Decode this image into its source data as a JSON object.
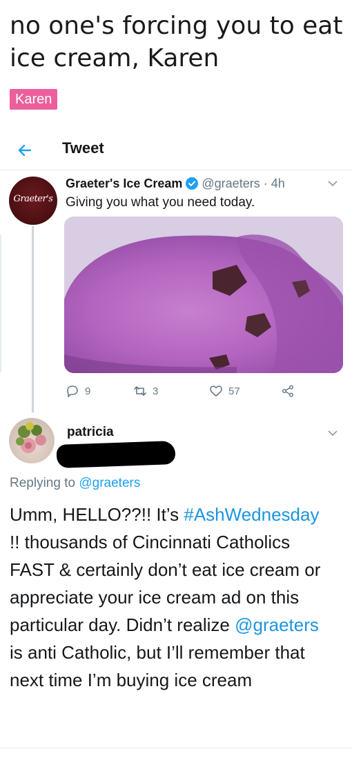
{
  "post": {
    "title": "no one's forcing you to eat ice cream, Karen",
    "flair": "Karen"
  },
  "header": {
    "title": "Tweet"
  },
  "tweet": {
    "author_name": "Graeter's Ice Cream",
    "handle": "@graeters",
    "time": "· 4h",
    "avatar_text": "Graeter's",
    "text": "Giving you what you need today.",
    "image": "ice-cream-photo",
    "replies": "9",
    "retweets": "3",
    "likes": "57"
  },
  "reply": {
    "name": "patricia",
    "replying_prefix": "Replying to ",
    "replying_handle": "@graeters",
    "text_1": "Umm, HELLO??!!  It’s ",
    "hashtag": "#AshWednesday",
    "text_2": " !! thousands of Cincinnati Catholics FAST & certainly don’t eat ice cream or appreciate your ice cream ad on this particular day. Didn’t realize ",
    "mention": "@graeters",
    "text_3": " is anti Catholic, but I’ll remember that next time I’m buying ice cream"
  },
  "colors": {
    "flair": "#ec5f9c",
    "link": "#1b95e0",
    "verified": "#1da1f2"
  }
}
